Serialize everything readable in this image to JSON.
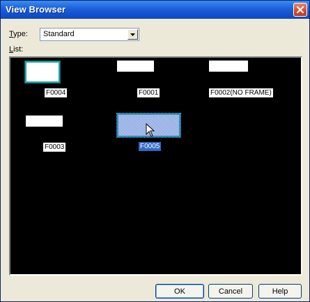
{
  "window": {
    "title": "View Browser"
  },
  "type": {
    "label_first": "T",
    "label_rest": "ype:",
    "value": "Standard"
  },
  "list": {
    "label_first": "L",
    "label_rest": "ist:",
    "items": [
      {
        "name": "F0004",
        "selected": false
      },
      {
        "name": "F0001",
        "selected": false
      },
      {
        "name": "F0002(NO FRAME)",
        "selected": false
      },
      {
        "name": "F0003",
        "selected": false
      },
      {
        "name": "F0005",
        "selected": true
      }
    ]
  },
  "buttons": {
    "ok": "OK",
    "cancel": "Cancel",
    "help": "Help"
  },
  "colors": {
    "title_bar": "#1c5fd8",
    "list_background": "#000000",
    "selection": "#3169c6",
    "selected_thumb": "#9ab3e6"
  },
  "icons": [
    "close-icon",
    "chevron-down-icon",
    "mouse-cursor-icon"
  ]
}
